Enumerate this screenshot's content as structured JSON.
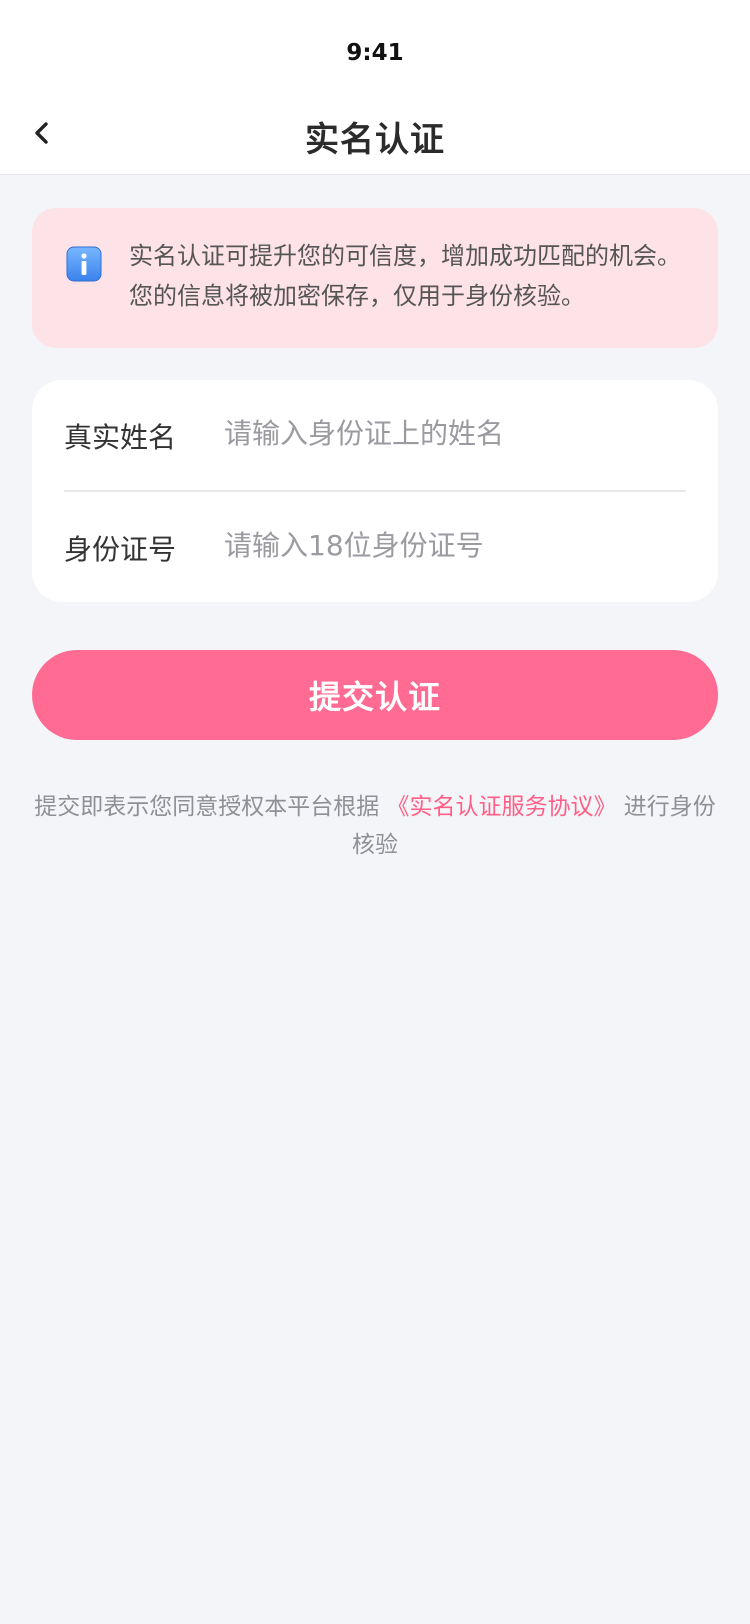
{
  "status_bar": {
    "time": "9:41"
  },
  "nav": {
    "back_icon": "chevron-left-icon",
    "title": "实名认证"
  },
  "notice": {
    "icon": "info-icon",
    "text": "实名认证可提升您的可信度，增加成功匹配的机会。您的信息将被加密保存，仅用于身份核验。",
    "background_color": "#fde2e8"
  },
  "form": {
    "name_field": {
      "label": "真实姓名",
      "value": "",
      "placeholder": "请输入身份证上的姓名"
    },
    "id_field": {
      "label": "身份证号",
      "value": "",
      "placeholder": "请输入18位身份证号"
    }
  },
  "submit": {
    "label": "提交认证",
    "color": "#ff6b92"
  },
  "agreement": {
    "prefix": "提交即表示您同意授权本平台根据 ",
    "link_text": "《实名认证服务协议》",
    "suffix": " 进行身份核验",
    "link_color": "#ff5f86"
  }
}
